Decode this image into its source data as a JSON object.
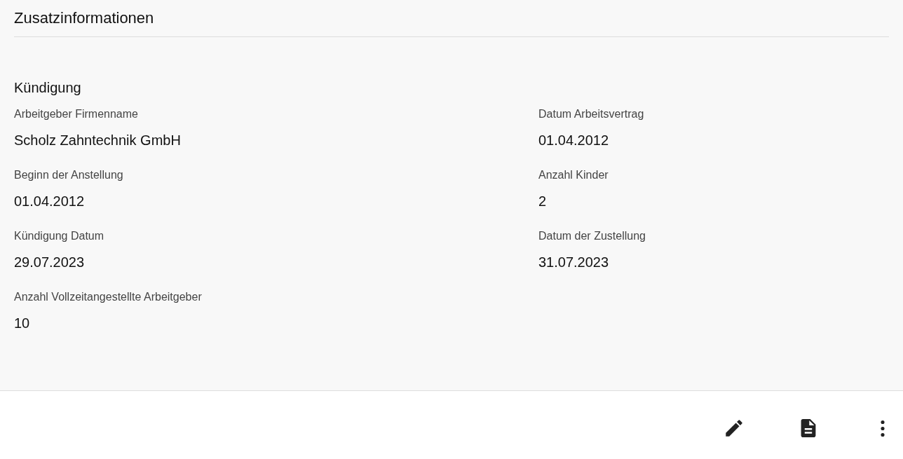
{
  "panel": {
    "title": "Zusatzinformationen",
    "section": "Kündigung",
    "fields": [
      {
        "label": "Arbeitgeber Firmenname",
        "value": "Scholz Zahntechnik GmbH"
      },
      {
        "label": "Datum Arbeitsvertrag",
        "value": "01.04.2012"
      },
      {
        "label": "Beginn der Anstellung",
        "value": "01.04.2012"
      },
      {
        "label": "Anzahl Kinder",
        "value": "2"
      },
      {
        "label": "Kündigung Datum",
        "value": "29.07.2023"
      },
      {
        "label": "Datum der Zustellung",
        "value": "31.07.2023"
      },
      {
        "label": "Anzahl Vollzeitangestellte Arbeitgeber",
        "value": "10"
      }
    ]
  },
  "actions": [
    {
      "kind": "edit"
    },
    {
      "kind": "document"
    },
    {
      "kind": "more"
    }
  ]
}
